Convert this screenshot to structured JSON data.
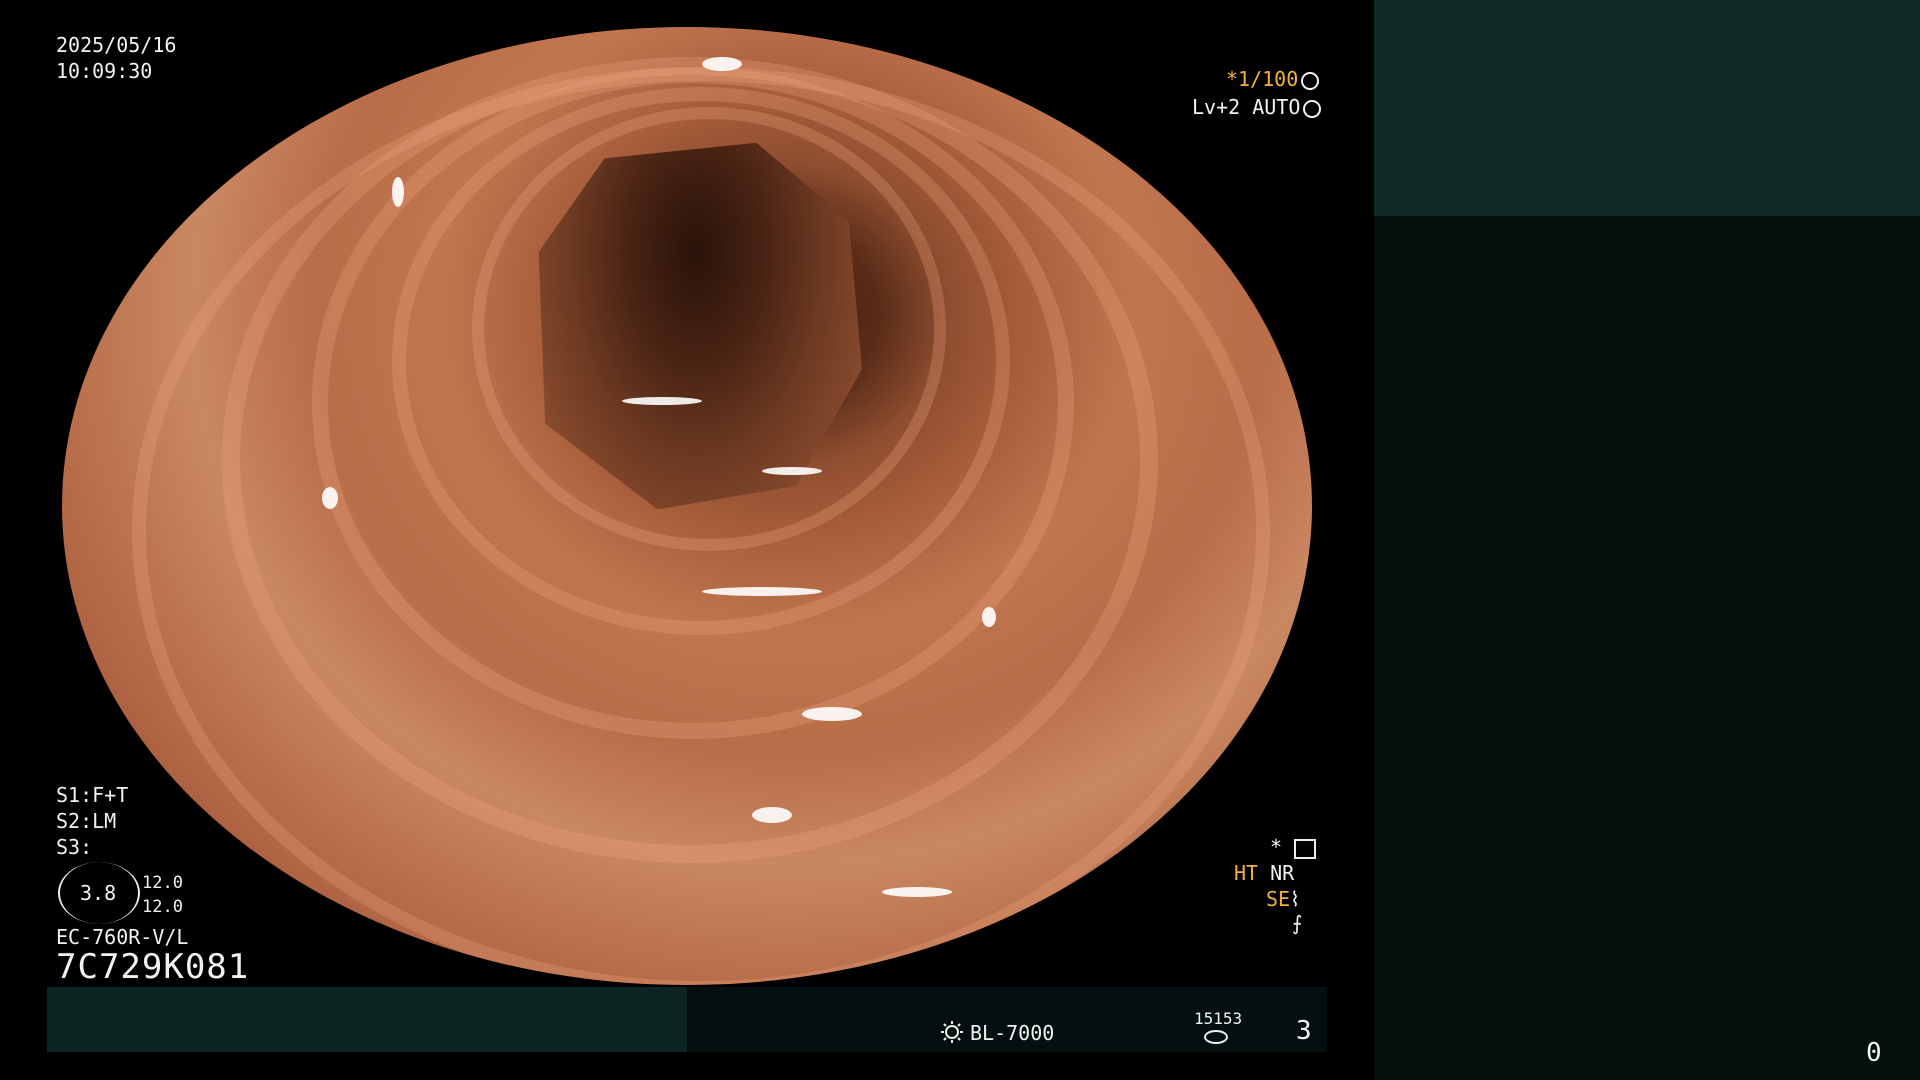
{
  "overlay": {
    "date": "2025/05/16",
    "time": "10:09:30",
    "shutter": "*1/100",
    "level": "Lv+2 AUTO",
    "s1": "S1:F+T",
    "s2": "S2:LM",
    "s3": "S3:",
    "aperture_value": "3.8",
    "aperture_top": "12.0",
    "aperture_bottom": "12.0",
    "scope_model": "EC-760R-V/L",
    "scope_serial": "7C729K081",
    "star_label": "*",
    "ht_label": "HT",
    "nr_label": "NR",
    "se_label": "SE",
    "light_source": "BL-7000",
    "counter": "15153",
    "image_number": "3",
    "right_corner_number": "0"
  },
  "colors": {
    "accent_orange": "#f0b23c",
    "panel_teal": "#112927",
    "panel_dark": "#050f0e",
    "tissue": "#b86c47"
  },
  "icons": [
    "shutter-mode-icon",
    "auto-iris-icon",
    "histogram-icon",
    "enhancement-icon",
    "structure-icon",
    "lamp-icon",
    "counter-icon"
  ]
}
